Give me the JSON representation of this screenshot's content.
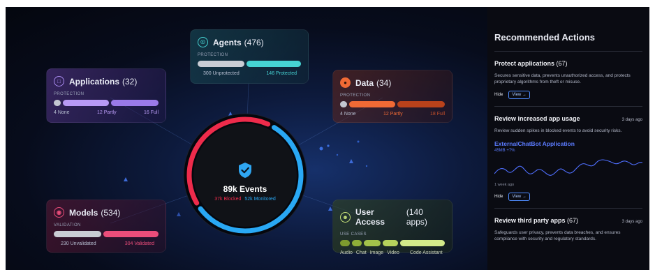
{
  "colors": {
    "accent_blue": "#29a8f4",
    "accent_red": "#ee2b4b",
    "applications": "#a98bf0",
    "agents": "#46d3d3",
    "data": "#f06a35",
    "models": "#ea4d7a",
    "user_access": "#c7e27a",
    "link": "#5b7bff"
  },
  "cards": {
    "applications": {
      "icon": "app-window-icon",
      "title": "Applications",
      "count": "(32)",
      "subtitle": "PROTECTION",
      "labels": [
        "4 None",
        "12 Partly",
        "16 Full"
      ]
    },
    "agents": {
      "icon": "agent-icon",
      "title": "Agents",
      "count": "(476)",
      "subtitle": "PROTECTION",
      "labels": [
        "300 Unprotected",
        "146 Protected"
      ]
    },
    "data": {
      "icon": "database-icon",
      "title": "Data",
      "count": "(34)",
      "subtitle": "PROTECTION",
      "labels": [
        "4 None",
        "12 Partly",
        "18 Full"
      ]
    },
    "models": {
      "icon": "model-icon",
      "title": "Models",
      "count": "(534)",
      "subtitle": "VALIDATION",
      "labels": [
        "230 Unvalidated",
        "304 Validated"
      ]
    },
    "user_access": {
      "icon": "users-icon",
      "title": "User Access",
      "count": "(140 apps)",
      "subtitle": "USE CASES",
      "labels": [
        "Audio",
        "Chat",
        "Image",
        "Video",
        "Code Assistant"
      ]
    }
  },
  "center": {
    "icon": "shield-check-icon",
    "title": "89k Events",
    "blocked": "37k Blocked",
    "monitored": "52k Monitored",
    "blocked_fraction": 0.42
  },
  "panel": {
    "title": "Recommended Actions",
    "items": [
      {
        "title": "Protect applications",
        "count": "(67)",
        "time": "",
        "desc": "Secures sensitive data, prevents unauthorized access, and protects proprietary algorithms from theft or misuse.",
        "hide": "Hide",
        "view": "View →"
      },
      {
        "title": "Review increased app usage",
        "count": "",
        "time": "3 days ago",
        "desc": "Review sudden spikes in blocked events to avoid security risks.",
        "app_name": "ExternalChatBot Application",
        "app_stat": "45MB +7%",
        "caption": "1 week ago",
        "hide": "Hide",
        "view": "View →"
      },
      {
        "title": "Review third party apps",
        "count": "(67)",
        "time": "3 days ago",
        "desc": "Safeguards user privacy, prevents data breaches, and ensures compliance with security and regulatory standards."
      }
    ]
  }
}
